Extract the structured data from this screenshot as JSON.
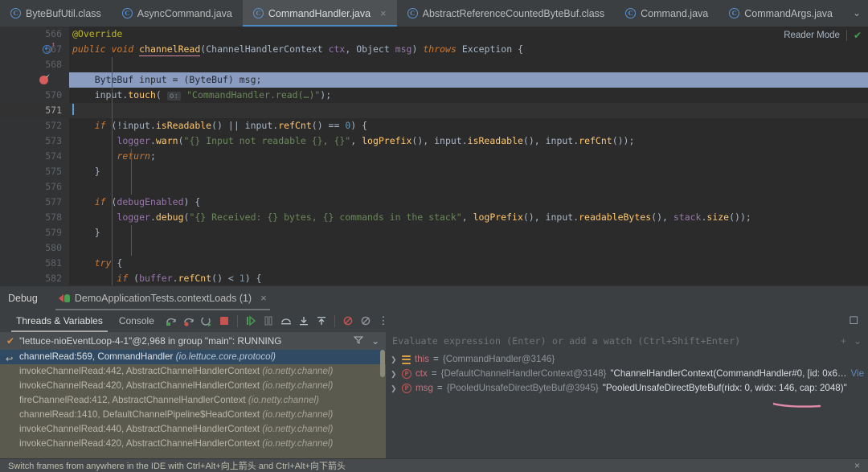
{
  "tabs": [
    {
      "label": "ByteBufUtil.class",
      "icon": "java-class-icon",
      "active": false,
      "closable": false
    },
    {
      "label": "AsyncCommand.java",
      "icon": "java-class-icon",
      "active": false,
      "closable": false
    },
    {
      "label": "CommandHandler.java",
      "icon": "java-class-icon",
      "active": true,
      "closable": true
    },
    {
      "label": "AbstractReferenceCountedByteBuf.class",
      "icon": "java-class-icon",
      "active": false,
      "closable": false
    },
    {
      "label": "Command.java",
      "icon": "java-class-icon",
      "active": false,
      "closable": false
    },
    {
      "label": "CommandArgs.java",
      "icon": "java-class-icon",
      "active": false,
      "closable": false
    }
  ],
  "tabbar": {
    "overflow_label": "⌄",
    "more_label": "⋮"
  },
  "editor": {
    "reader_mode_label": "Reader Mode",
    "inspection_status": "✔",
    "lines": [
      {
        "num": "566",
        "gutter_icon": "none"
      },
      {
        "num": "567",
        "gutter_icon": "override-method-icon"
      },
      {
        "num": "568",
        "gutter_icon": "none"
      },
      {
        "num": "569",
        "gutter_icon": "breakpoint-verified-icon",
        "highlighted": true
      },
      {
        "num": "570",
        "gutter_icon": "none"
      },
      {
        "num": "571",
        "gutter_icon": "none",
        "current": true
      },
      {
        "num": "572",
        "gutter_icon": "none"
      },
      {
        "num": "573",
        "gutter_icon": "none"
      },
      {
        "num": "574",
        "gutter_icon": "none"
      },
      {
        "num": "575",
        "gutter_icon": "none"
      },
      {
        "num": "576",
        "gutter_icon": "none"
      },
      {
        "num": "577",
        "gutter_icon": "none"
      },
      {
        "num": "578",
        "gutter_icon": "none"
      },
      {
        "num": "579",
        "gutter_icon": "none"
      },
      {
        "num": "580",
        "gutter_icon": "none"
      },
      {
        "num": "581",
        "gutter_icon": "none"
      },
      {
        "num": "582",
        "gutter_icon": "none"
      }
    ],
    "code_text": [
      "@Override",
      "public void channelRead(ChannelHandlerContext ctx, Object msg) throws Exception {",
      "",
      "    ByteBuf input = (ByteBuf) msg;",
      "    input.touch( o: \"CommandHandler.read(…)\");",
      "",
      "    if (!input.isReadable() || input.refCnt() == 0) {",
      "        logger.warn(\"{} Input not readable {}, {}\", logPrefix(), input.isReadable(), input.refCnt());",
      "        return;",
      "    }",
      "",
      "    if (debugEnabled) {",
      "        logger.debug(\"{} Received: {} bytes, {} commands in the stack\", logPrefix(), input.readableBytes(), stack.size());",
      "    }",
      "",
      "    try {",
      "        if (buffer.refCnt() < 1) {"
    ],
    "touch_param_hint": "o:"
  },
  "debug": {
    "panel_title": "Debug",
    "session_name": "DemoApplicationTests.contextLoads (1)",
    "session_close": "×",
    "tabs": [
      {
        "label": "Threads & Variables",
        "selected": true
      },
      {
        "label": "Console",
        "selected": false
      }
    ],
    "toolbar_icons": [
      "step-over-icon",
      "step-into-icon",
      "force-step-into-icon",
      "stop-icon",
      "resume-program-icon",
      "pause-program-icon",
      "step-out-icon",
      "run-to-cursor-icon",
      "drop-frame-icon",
      "mute-breakpoints-icon",
      "view-breakpoints-icon",
      "more-options-icon"
    ],
    "settings_icon": "settings-icon",
    "thread": {
      "label": "\"lettuce-nioEventLoop-4-1\"@2,968 in group \"main\": RUNNING",
      "filter_icon": "filter-icon",
      "chevron_icon": "chevron-down-icon"
    },
    "frames": [
      {
        "method": "channelRead:569, CommandHandler",
        "package": "(io.lettuce.core.protocol)",
        "selected": true
      },
      {
        "method": "invokeChannelRead:442, AbstractChannelHandlerContext",
        "package": "(io.netty.channel)",
        "selected": false
      },
      {
        "method": "invokeChannelRead:420, AbstractChannelHandlerContext",
        "package": "(io.netty.channel)",
        "selected": false
      },
      {
        "method": "fireChannelRead:412, AbstractChannelHandlerContext",
        "package": "(io.netty.channel)",
        "selected": false
      },
      {
        "method": "channelRead:1410, DefaultChannelPipeline$HeadContext",
        "package": "(io.netty.channel)",
        "selected": false
      },
      {
        "method": "invokeChannelRead:440, AbstractChannelHandlerContext",
        "package": "(io.netty.channel)",
        "selected": false
      },
      {
        "method": "invokeChannelRead:420, AbstractChannelHandlerContext",
        "package": "(io.netty.channel)",
        "selected": false
      }
    ],
    "evaluate_placeholder": "Evaluate expression (Enter) or add a watch (Ctrl+Shift+Enter)",
    "variables": [
      {
        "icon": "this-object-icon",
        "name": "this",
        "equals": "=",
        "reference": "{CommandHandler@3146}",
        "value": "",
        "view_link": ""
      },
      {
        "icon": "parameter-icon",
        "name": "ctx",
        "equals": "=",
        "reference": "{DefaultChannelHandlerContext@3148}",
        "value": "\"ChannelHandlerContext(CommandHandler#0, [id: 0x6…",
        "view_link": "Vie"
      },
      {
        "icon": "parameter-icon",
        "name": "msg",
        "equals": "=",
        "reference": "{PooledUnsafeDirectByteBuf@3945}",
        "value": "\"PooledUnsafeDirectByteBuf(ridx: 0, widx: 146, cap: 2048)\"",
        "view_link": ""
      }
    ],
    "add_watch_icon": "add-watch-icon",
    "vars_chevron_icon": "chevron-down-icon"
  },
  "statusbar": {
    "message": "Switch frames from anywhere in the IDE with Ctrl+Alt+向上箭头 and Ctrl+Alt+向下箭头",
    "close_icon": "×"
  },
  "colors": {
    "accent_blue": "#4a88c7",
    "breakpoint_red": "#db5c5c",
    "annotation_pink": "#e08ba8",
    "frame_selected": "#2f4a62",
    "frames_bg": "#5b5a4e",
    "editor_bg": "#2b2b2b"
  }
}
